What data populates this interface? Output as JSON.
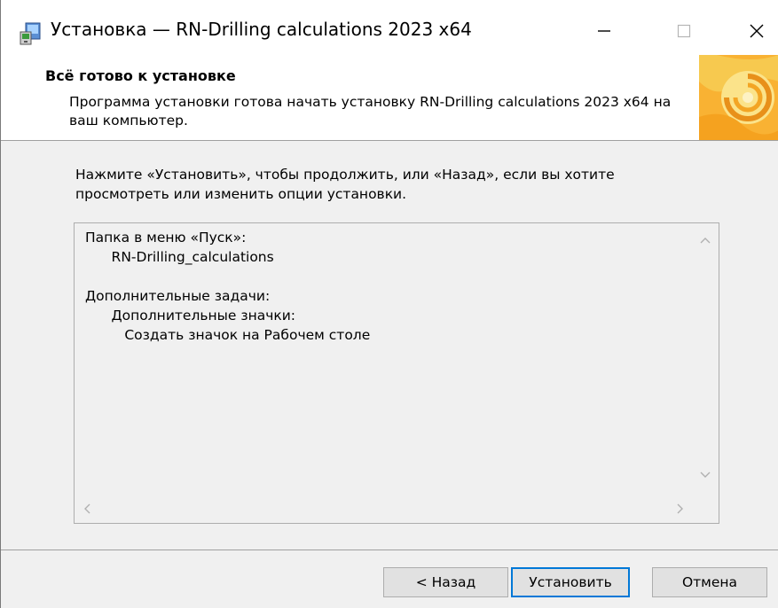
{
  "window": {
    "title": "Установка — RN-Drilling calculations 2023 x64",
    "app_icon": "installer-computer-icon",
    "controls": {
      "minimize": "minimize-icon",
      "maximize": "maximize-icon",
      "close": "close-icon"
    }
  },
  "header": {
    "title": "Всё готово к установке",
    "description": "Программа установки готова начать установку RN-Drilling calculations 2023 x64 на ваш компьютер.",
    "logo": "installer-swirl-logo"
  },
  "main": {
    "intro": "Нажмите «Установить», чтобы продолжить, или «Назад», если вы хотите просмотреть или изменить опции установки.",
    "memo_lines": [
      "Папка в меню «Пуск»:",
      "      RN-Drilling_calculations",
      "",
      "Дополнительные задачи:",
      "      Дополнительные значки:",
      "         Создать значок на Рабочем столе"
    ]
  },
  "buttons": {
    "back": "< Назад",
    "install": "Установить",
    "cancel": "Отмена"
  },
  "colors": {
    "window_bg": "#f0f0f0",
    "header_bg": "#ffffff",
    "default_button_border": "#0078d7",
    "button_bg": "#e1e1e1"
  }
}
